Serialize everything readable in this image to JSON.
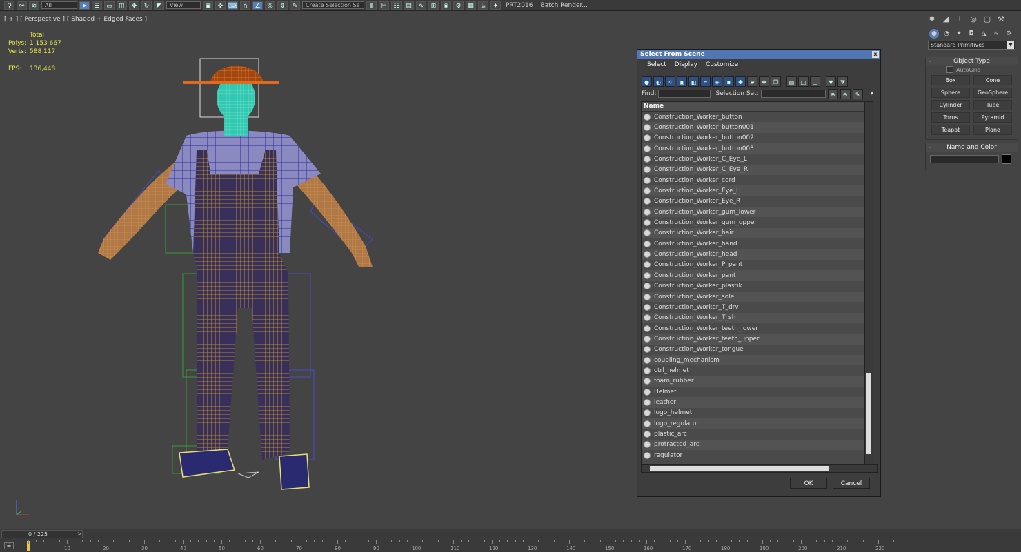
{
  "toolbar": {
    "selection_filter": "All",
    "reference_coord": "View",
    "named_selection": "Create Selection Se",
    "prt_label": "PRT2016",
    "batch_render_label": "Batch Render..."
  },
  "viewport": {
    "label": "[ + ] [ Perspective ] [ Shaded + Edged Faces ]",
    "stats_header": "Total",
    "polys_label": "Polys:",
    "polys_value": "1 153 667",
    "verts_label": "Verts:",
    "verts_value": "588 117",
    "fps_label": "FPS:",
    "fps_value": "136,448"
  },
  "dialog": {
    "title": "Select From Scene",
    "close_label": "x",
    "menu": {
      "select": "Select",
      "display": "Display",
      "customize": "Customize"
    },
    "find_label": "Find:",
    "selection_set_label": "Selection Set:",
    "column_name": "Name",
    "items": [
      "Construction_Worker_button",
      "Construction_Worker_button001",
      "Construction_Worker_button002",
      "Construction_Worker_button003",
      "Construction_Worker_C_Eye_L",
      "Construction_Worker_C_Eye_R",
      "Construction_Worker_cord",
      "Construction_Worker_Eye_L",
      "Construction_Worker_Eye_R",
      "Construction_Worker_gum_lower",
      "Construction_Worker_gum_upper",
      "Construction_Worker_hair",
      "Construction_Worker_hand",
      "Construction_Worker_head",
      "Construction_Worker_P_pant",
      "Construction_Worker_pant",
      "Construction_Worker_plastik",
      "Construction_Worker_sole",
      "Construction_Worker_T_drv",
      "Construction_Worker_T_sh",
      "Construction_Worker_teeth_lower",
      "Construction_Worker_teeth_upper",
      "Construction_Worker_tongue",
      "coupling_mechanism",
      "ctrl_helmet",
      "foam_rubber",
      "Helmet",
      "leather",
      "logo_helmet",
      "logo_regulator",
      "plastic_arc",
      "protracted_arc",
      "regulator"
    ],
    "ok_label": "OK",
    "cancel_label": "Cancel"
  },
  "command_panel": {
    "category": "Standard Primitives",
    "object_type_title": "Object Type",
    "autogrid_label": "AutoGrid",
    "buttons": [
      "Box",
      "Cone",
      "Sphere",
      "GeoSphere",
      "Cylinder",
      "Tube",
      "Torus",
      "Pyramid",
      "Teapot",
      "Plane"
    ],
    "name_color_title": "Name and Color"
  },
  "timeline": {
    "frame_label": "0 / 225",
    "ticks": [
      "10",
      "20",
      "30",
      "40",
      "50",
      "60",
      "70",
      "80",
      "90",
      "100",
      "110",
      "120",
      "130",
      "140",
      "150",
      "160",
      "170",
      "180",
      "190",
      "200",
      "210",
      "220"
    ]
  }
}
